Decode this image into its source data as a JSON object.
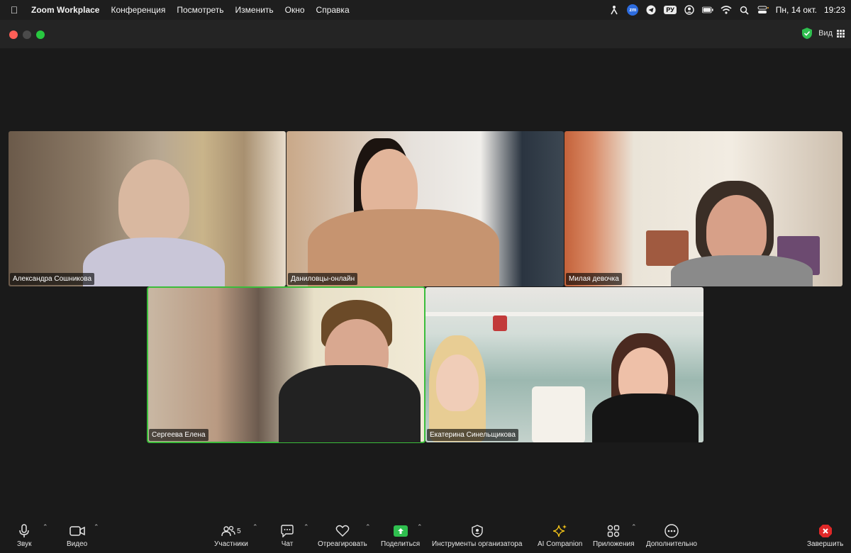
{
  "menubar": {
    "app_name": "Zoom Workplace",
    "menus": [
      "Конференция",
      "Посмотреть",
      "Изменить",
      "Окно",
      "Справка"
    ],
    "input_language": "РУ",
    "date": "Пн, 14 окт.",
    "time": "19:23",
    "zoom_badge": "zm"
  },
  "window": {
    "view_label": "Вид"
  },
  "participants": [
    {
      "name": "Александра Сошникова",
      "active_speaker": false
    },
    {
      "name": "Даниловцы-онлайн",
      "active_speaker": false
    },
    {
      "name": "Милая девочка",
      "active_speaker": false
    },
    {
      "name": "Сергеева Елена",
      "active_speaker": true
    },
    {
      "name": "Екатерина Синельщикова",
      "active_speaker": false
    }
  ],
  "toolbar": {
    "audio_label": "Звук",
    "video_label": "Видео",
    "participants_label": "Участники",
    "participants_count": "5",
    "chat_label": "Чат",
    "react_label": "Отреагировать",
    "share_label": "Поделиться",
    "host_tools_label": "Инструменты организатора",
    "ai_label": "AI Companion",
    "apps_label": "Приложения",
    "more_label": "Дополнительно",
    "end_label": "Завершить"
  },
  "colors": {
    "active_speaker_border": "#3bbd3b",
    "share_green": "#2fbf4f",
    "end_red": "#e02828",
    "ai_yellow": "#f5c518"
  }
}
